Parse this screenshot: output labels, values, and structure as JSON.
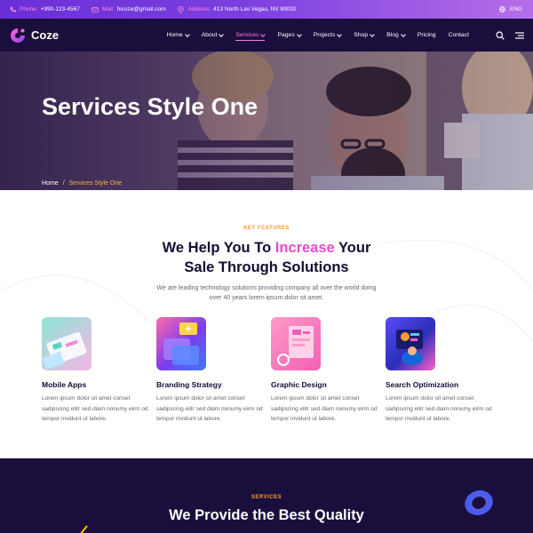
{
  "topbar": {
    "phone_label": "Phone:",
    "phone_value": "+990-123-4567",
    "mail_label": "Mail:",
    "mail_value": "hicoze@gmail.com",
    "address_label": "Address:",
    "address_value": "413 North Las Vegas, NV 89032",
    "language": "ENG"
  },
  "header": {
    "logo_text": "Coze",
    "nav": [
      {
        "label": "Home"
      },
      {
        "label": "About"
      },
      {
        "label": "Services"
      },
      {
        "label": "Pages"
      },
      {
        "label": "Projects"
      },
      {
        "label": "Shop"
      },
      {
        "label": "Blog"
      },
      {
        "label": "Pricing"
      },
      {
        "label": "Contact"
      }
    ]
  },
  "hero": {
    "title": "Services Style One",
    "breadcrumb_home": "Home",
    "breadcrumb_sep": "/",
    "breadcrumb_current": "Services Style One"
  },
  "features": {
    "tag": "KEY FEATURES",
    "title_part1": "We Help You To ",
    "title_highlight": "Increase",
    "title_part2": " Your",
    "title_line2": "Sale Through Solutions",
    "subtitle_line1": "We are leading technology solutions providing company all over the world doing",
    "subtitle_line2": "over 40 years lorem ipsum dolor sit amet.",
    "cards": [
      {
        "title": "Mobile Apps",
        "text": "Lorem ipsum dolor sit amet conset sadipscing elitr sed diam nonumy eirm od tempor invidunt ut labore."
      },
      {
        "title": "Branding Strategy",
        "text": "Lorem ipsum dolor sit amet conset sadipscing elitr sed diam nonumy eirm od tempor invidunt ut labore."
      },
      {
        "title": "Graphic Design",
        "text": "Lorem ipsum dolor sit amet conset sadipscing elitr sed diam nonumy eirm od tempor invidunt ut labore."
      },
      {
        "title": "Search Optimization",
        "text": "Lorem ipsum dolor sit amet conset sadipscing elitr sed diam nonumy eirm od tempor invidunt ut labore."
      }
    ]
  },
  "services": {
    "tag": "SERVICES",
    "title": "We Provide the Best Quality"
  },
  "colors": {
    "accent_pink": "#e34dd0",
    "accent_orange": "#ff9d2e",
    "dark_navy": "#1a0f3c",
    "topbar_purple": "#6a2fd8"
  },
  "icons": [
    "phone-icon",
    "mail-icon",
    "location-icon",
    "globe-icon",
    "search-icon",
    "menu-icon"
  ]
}
